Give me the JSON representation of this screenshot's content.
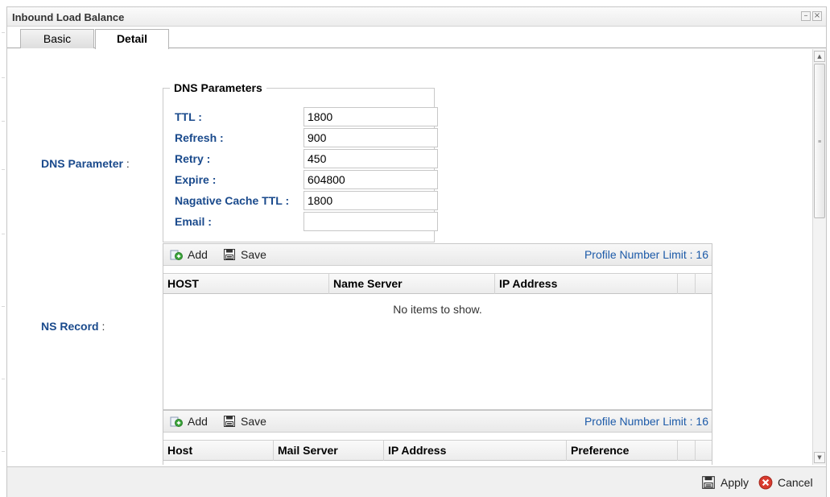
{
  "window": {
    "title": "Inbound Load Balance",
    "minimize_glyph": "–",
    "close_glyph": "×"
  },
  "tabs": [
    {
      "label": "Basic",
      "active": false
    },
    {
      "label": "Detail",
      "active": true
    }
  ],
  "dns_parameter": {
    "row_label": "DNS Parameter",
    "colon": " :",
    "legend": "DNS Parameters",
    "fields": [
      {
        "label": "TTL :",
        "value": "1800"
      },
      {
        "label": "Refresh :",
        "value": "900"
      },
      {
        "label": "Retry :",
        "value": "450"
      },
      {
        "label": "Expire :",
        "value": "604800"
      },
      {
        "label": "Nagative Cache TTL :",
        "value": "1800"
      },
      {
        "label": "Email :",
        "value": ""
      }
    ]
  },
  "ns_record": {
    "row_label": "NS Record",
    "colon": " :",
    "toolbar": {
      "add_label": "Add",
      "save_label": "Save",
      "limit_text": "Profile Number Limit : 16"
    },
    "columns": [
      "HOST",
      "Name Server",
      "IP Address"
    ],
    "empty_text": "No items to show."
  },
  "mx_record": {
    "toolbar": {
      "add_label": "Add",
      "save_label": "Save",
      "limit_text": "Profile Number Limit : 16"
    },
    "columns": [
      "Host",
      "Mail Server",
      "IP Address",
      "Preference"
    ]
  },
  "footer": {
    "apply_label": "Apply",
    "cancel_label": "Cancel"
  },
  "colors": {
    "label_blue": "#1a4a8c",
    "limit_blue": "#1c5aa8",
    "add_green": "#3aa53a",
    "cancel_red": "#d93a2e"
  }
}
